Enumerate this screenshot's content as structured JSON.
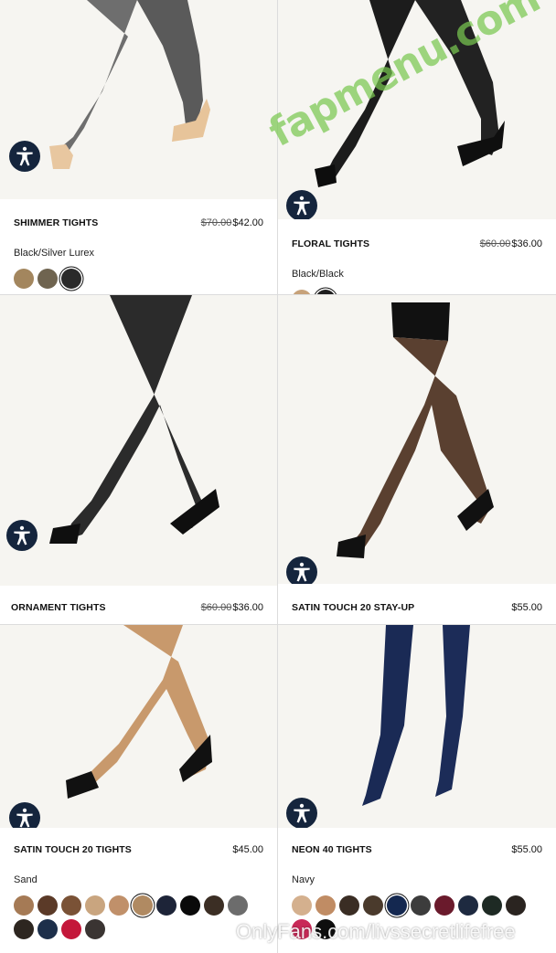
{
  "products": [
    {
      "name": "SHIMMER TIGHTS",
      "old_price": "$70.00",
      "price": "$42.00",
      "color_name": "Black/Silver Lurex",
      "swatches": [
        "#a3865e",
        "#6f6450",
        "#2a2a2a"
      ],
      "selected": 2
    },
    {
      "name": "FLORAL TIGHTS",
      "old_price": "$60.00",
      "price": "$36.00",
      "color_name": "Black/Black",
      "swatches": [
        "#c7a27a",
        "#1e1e1e"
      ],
      "selected": 1
    },
    {
      "name": "ORNAMENT TIGHTS",
      "old_price": "$60.00",
      "price": "$36.00"
    },
    {
      "name": "SATIN TOUCH 20 STAY-UP",
      "price": "$55.00"
    },
    {
      "name": "SATIN TOUCH 20 TIGHTS",
      "price": "$45.00",
      "color_name": "Sand",
      "swatches": [
        "#a57a55",
        "#5b3a28",
        "#7a5236",
        "#c9a57f",
        "#c0906a",
        "#b08a62",
        "#1d2438",
        "#0a0a0a",
        "#3b2e24",
        "#6c6c6c",
        "#2d2620",
        "#1d2f4a",
        "#c4173a",
        "#3a3432"
      ],
      "selected": 5
    },
    {
      "name": "NEON 40 TIGHTS",
      "price": "$55.00",
      "color_name": "Navy",
      "swatches": [
        "#d4b08e",
        "#c08c64",
        "#3a2d24",
        "#4a3a2c",
        "#142850",
        "#3c3c3c",
        "#6a1a2c",
        "#1e2a40",
        "#1e2a24",
        "#2a2420",
        "#c82a58",
        "#0e0e0e"
      ],
      "selected": 4
    }
  ],
  "accessibility_icon": "accessibility-person-icon",
  "watermarks": {
    "top": "fapmenu.com",
    "bottom": "OnlyFans.com/livssecretlifefree"
  }
}
